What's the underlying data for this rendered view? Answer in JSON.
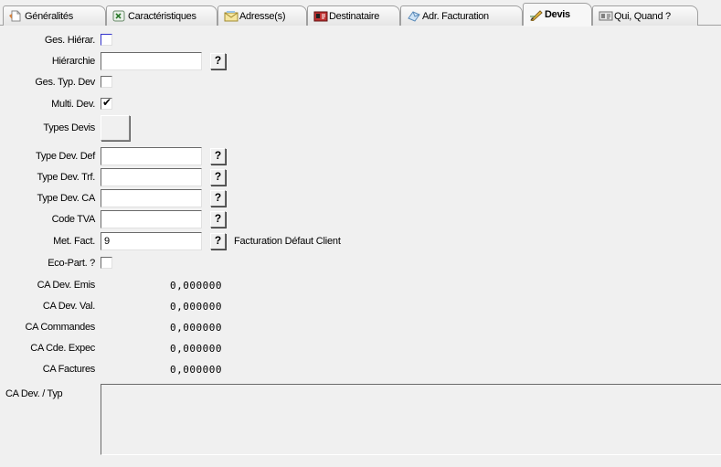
{
  "tabs": [
    {
      "label": "Généralités",
      "icon": "page-icon"
    },
    {
      "label": "Caractéristiques",
      "icon": "excel-icon"
    },
    {
      "label": "Adresse(s)",
      "icon": "envelope-icon"
    },
    {
      "label": "Destinataire",
      "icon": "contact-card-icon"
    },
    {
      "label": "Adr. Facturation",
      "icon": "mail-icon"
    },
    {
      "label": "Devis",
      "icon": "pencil-icon",
      "active": true
    },
    {
      "label": "Qui, Quand ?",
      "icon": "id-card-icon"
    }
  ],
  "form": {
    "ges_hierar": {
      "label": "Ges. Hiérar.",
      "checked": false
    },
    "hierarchie": {
      "label": "Hiérarchie",
      "value": "",
      "btn": "?"
    },
    "ges_typ_dev": {
      "label": "Ges. Typ. Dev",
      "checked": false
    },
    "multi_dev": {
      "label": "Multi. Dev.",
      "checked": true,
      "mark": "✔"
    },
    "types_devis": {
      "label": "Types Devis"
    },
    "type_dev_def": {
      "label": "Type Dev. Def",
      "value": "",
      "btn": "?"
    },
    "type_dev_trf": {
      "label": "Type Dev. Trf.",
      "value": "",
      "btn": "?"
    },
    "type_dev_ca": {
      "label": "Type Dev. CA",
      "value": "",
      "btn": "?"
    },
    "code_tva": {
      "label": "Code TVA",
      "value": "",
      "btn": "?"
    },
    "met_fact": {
      "label": "Met. Fact.",
      "value": "9",
      "btn": "?",
      "desc": "Facturation Défaut Client"
    },
    "eco_part": {
      "label": "Eco-Part. ?",
      "checked": false
    },
    "ca_dev_emis": {
      "label": "CA Dev. Emis",
      "value": "0,000000"
    },
    "ca_dev_val": {
      "label": "CA Dev. Val.",
      "value": "0,000000"
    },
    "ca_commandes": {
      "label": "CA Commandes",
      "value": "0,000000"
    },
    "ca_cde_expec": {
      "label": "CA Cde. Expec",
      "value": "0,000000"
    },
    "ca_factures": {
      "label": "CA Factures",
      "value": "0,000000"
    },
    "ca_dev_typ": {
      "label": "CA Dev. / Typ"
    }
  },
  "colors": {
    "background": "#f0f0f0",
    "field_bg": "#ffffff",
    "focus_accent": "#3333cc"
  }
}
